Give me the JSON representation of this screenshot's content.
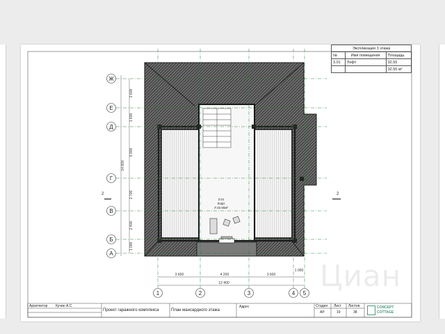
{
  "explication": {
    "title": "Экспликация 3 этажа",
    "col_no": "№",
    "col_name": "Имя помещения",
    "col_area": "Площадь",
    "rows": [
      {
        "no": "3.01",
        "name": "Лофт",
        "area": "32.55"
      }
    ],
    "total": "32.55 м²"
  },
  "axes_rows": [
    "Ж",
    "Е",
    "Д",
    "Г",
    "В",
    "Б",
    "А"
  ],
  "axes_cols": [
    "1",
    "2",
    "3",
    "4",
    "5"
  ],
  "dims_vertical": [
    "2 600",
    "1 600",
    "5 900",
    "2 700",
    "2 400",
    "1 000"
  ],
  "dim_vertical_total": "14 800",
  "dims_horizontal": [
    "3 600",
    "4 200",
    "3 600",
    "1 000"
  ],
  "dim_horizontal_total": "12 400",
  "section_mark": "2",
  "room_label": {
    "no": "3.01",
    "name": "Лофт",
    "area": "Л 32.55м²"
  },
  "stamp": {
    "role": "Архитектор",
    "person": "Кучин А.С.",
    "project": "Проект гаражного комплекса",
    "sheet_name": "План мансардного этажа",
    "address_label": "Адрес",
    "stage_label": "Стадия",
    "sheet_label": "Лист",
    "sheets_label": "Листов",
    "stage": "АР",
    "sheet": "19",
    "sheets": "38",
    "logo_line1": "CONCEPT",
    "logo_line2": "COTTAGE"
  },
  "watermark": "Циан",
  "colors": {
    "roof_hatch": "#3a3a3a",
    "wall": "#1f1f1f",
    "grid_line": "#2f7a3a",
    "floor": "#f2f2f2"
  }
}
